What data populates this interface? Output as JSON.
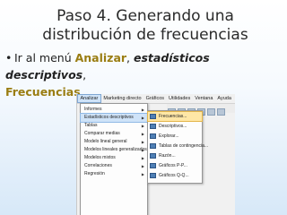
{
  "slide": {
    "title": "Paso 4. Generando una distribución de frecuencias",
    "bullet_symbol": "•",
    "bullet": {
      "prefix": "Ir al menú ",
      "analizar": "Analizar",
      "comma1": ", ",
      "estadisticos": "estadísticos descriptivos",
      "comma2": ",",
      "frecuencias": "Frecuencias"
    }
  },
  "screenshot": {
    "menubar": [
      "Analizar",
      "Marketing directo",
      "Gráficos",
      "Utilidades",
      "Ventana",
      "Ayuda"
    ],
    "analyze_menu": [
      {
        "label": "Informes",
        "arrow": "▶"
      },
      {
        "label": "Estadísticos descriptivos",
        "arrow": "▶"
      },
      {
        "label": "Tablas",
        "arrow": "▶"
      },
      {
        "label": "Comparar medias",
        "arrow": "▶"
      },
      {
        "label": "Modelo lineal general",
        "arrow": "▶"
      },
      {
        "label": "Modelos lineales generalizados",
        "arrow": "▶"
      },
      {
        "label": "Modelos mixtos",
        "arrow": "▶"
      },
      {
        "label": "Correlaciones",
        "arrow": "▶"
      },
      {
        "label": "Regresión",
        "arrow": "▶"
      }
    ],
    "descriptives_submenu": [
      "Frecuencias...",
      "Descriptivos...",
      "Explorar...",
      "Tablas de contingencia...",
      "Razón...",
      "Gráficos P-P...",
      "Gráficos Q-Q..."
    ]
  }
}
